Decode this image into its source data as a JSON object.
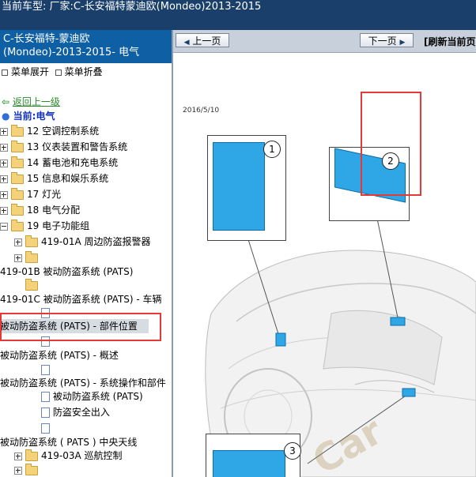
{
  "topbar": {
    "text": "当前车型:   厂家:C-长安福特蒙迪欧(Mondeo)2013-2015"
  },
  "left_panel": {
    "title": "C-长安福特-蒙迪欧(Mondeo)-2013-2015- 电气",
    "expand_all": "菜单展开",
    "collapse_all": "菜单折叠",
    "back_link": "返回上一级",
    "current": "当前:电气",
    "tree": {
      "i12": "12 空调控制系统",
      "i13": "13 仪表装置和警告系统",
      "i14": "14 蓄电池和充电系统",
      "i15": "15 信息和娱乐系统",
      "i17": "17 灯光",
      "i18": "18 电气分配",
      "i19": "19 电子功能组",
      "i419_01a": "419-01A 周边防盗报警器",
      "i419_01b": "419-01B 被动防盗系统 (PATS)",
      "i419_01c": "419-01C 被动防盗系统 (PATS) - 车辆",
      "parts": "被动防盗系统 (PATS) - 部件位置",
      "overview": "被动防盗系统 (PATS) - 概述",
      "ops": "被动防盗系统 (PATS) - 系统操作和部件",
      "pats": "被动防盗系统 (PATS)",
      "security": "防盗安全出入",
      "antenna": "被动防盗系统 ( PATS ) 中央天线",
      "i419_03a": "419-03A 巡航控制"
    }
  },
  "right_panel": {
    "prev": "上一页",
    "next": "下一页",
    "refresh": "[刷新当前页",
    "date": "2016/5/10",
    "callouts": [
      "1",
      "2",
      "3"
    ],
    "watermark": "Car"
  },
  "colors": {
    "topbar": "#1a3f6b",
    "left_header": "#0e5fa3",
    "part_blue": "#2fa6e6",
    "annotation_red": "#e53935"
  }
}
